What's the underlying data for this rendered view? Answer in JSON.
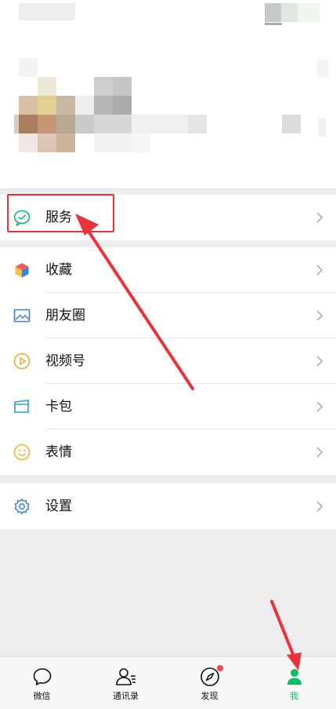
{
  "menu": {
    "service": {
      "label": "服务",
      "icon": "wechat-pay-icon"
    },
    "group2": [
      {
        "label": "收藏",
        "icon": "favorites-cube-icon"
      },
      {
        "label": "朋友圈",
        "icon": "moments-photo-icon"
      },
      {
        "label": "视频号",
        "icon": "channels-play-icon"
      },
      {
        "label": "卡包",
        "icon": "card-wallet-icon"
      },
      {
        "label": "表情",
        "icon": "sticker-smile-icon"
      }
    ],
    "settings": {
      "label": "设置",
      "icon": "gear-icon"
    }
  },
  "tabbar": {
    "tabs": [
      {
        "label": "微信",
        "icon": "chat-bubble-icon",
        "active": false
      },
      {
        "label": "通讯录",
        "icon": "contacts-icon",
        "active": false
      },
      {
        "label": "发现",
        "icon": "compass-icon",
        "active": false,
        "badge": true
      },
      {
        "label": "我",
        "icon": "person-icon",
        "active": true
      }
    ]
  },
  "colors": {
    "accent_green": "#07c160",
    "annotation_red": "#e8333a"
  }
}
